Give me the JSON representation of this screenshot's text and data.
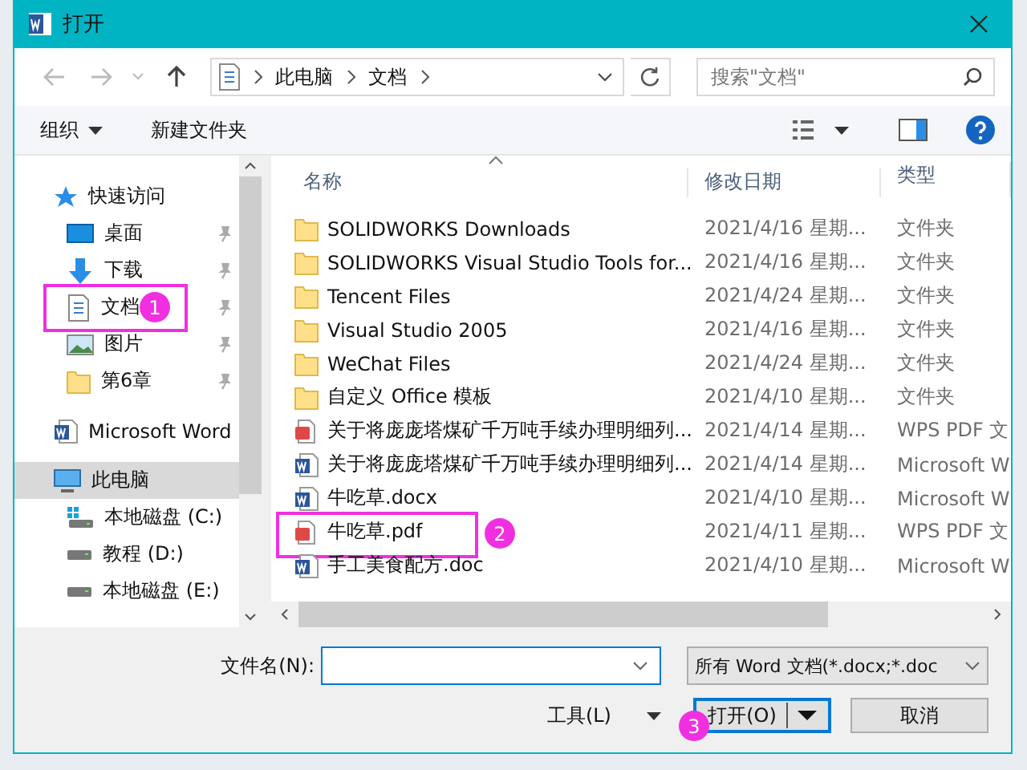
{
  "window": {
    "title": "打开"
  },
  "address": {
    "path": [
      "此电脑",
      "文档"
    ]
  },
  "search": {
    "placeholder": "搜索\"文档\""
  },
  "toolbar": {
    "organize": "组织",
    "new_folder": "新建文件夹"
  },
  "sidebar": {
    "items": [
      {
        "label": "快速访问",
        "kind": "star",
        "pinned": false,
        "selected": false
      },
      {
        "label": "桌面",
        "kind": "desktop",
        "pinned": true,
        "selected": false
      },
      {
        "label": "下载",
        "kind": "download",
        "pinned": true,
        "selected": false
      },
      {
        "label": "文档",
        "kind": "document",
        "pinned": true,
        "selected": false,
        "callout": "1"
      },
      {
        "label": "图片",
        "kind": "picture",
        "pinned": true,
        "selected": false
      },
      {
        "label": "第6章",
        "kind": "folder",
        "pinned": true,
        "selected": false
      },
      {
        "label": "Microsoft Word",
        "kind": "word",
        "pinned": false,
        "selected": false
      },
      {
        "label": "此电脑",
        "kind": "pc",
        "pinned": false,
        "selected": true
      },
      {
        "label": "本地磁盘 (C:)",
        "kind": "system-drive",
        "pinned": false,
        "selected": false
      },
      {
        "label": "教程 (D:)",
        "kind": "drive",
        "pinned": false,
        "selected": false
      },
      {
        "label": "本地磁盘 (E:)",
        "kind": "drive",
        "pinned": false,
        "selected": false
      }
    ]
  },
  "columns": [
    "名称",
    "修改日期",
    "类型"
  ],
  "rows": [
    {
      "name": "SOLIDWORKS Downloads",
      "date": "2021/4/16 星期...",
      "type": "文件夹",
      "kind": "folder"
    },
    {
      "name": "SOLIDWORKS Visual Studio Tools for...",
      "date": "2021/4/16 星期...",
      "type": "文件夹",
      "kind": "folder"
    },
    {
      "name": "Tencent Files",
      "date": "2021/4/24 星期...",
      "type": "文件夹",
      "kind": "folder"
    },
    {
      "name": "Visual Studio 2005",
      "date": "2021/4/16 星期...",
      "type": "文件夹",
      "kind": "folder"
    },
    {
      "name": "WeChat Files",
      "date": "2021/4/24 星期...",
      "type": "文件夹",
      "kind": "folder"
    },
    {
      "name": "自定义 Office 模板",
      "date": "2021/4/10 星期...",
      "type": "文件夹",
      "kind": "folder"
    },
    {
      "name": "关于将庞庞塔煤矿千万吨手续办理明细列...",
      "date": "2021/4/14 星期...",
      "type": "WPS PDF 文",
      "kind": "pdf"
    },
    {
      "name": "关于将庞庞塔煤矿千万吨手续办理明细列...",
      "date": "2021/4/14 星期...",
      "type": "Microsoft W",
      "kind": "word"
    },
    {
      "name": "牛吃草.docx",
      "date": "2021/4/10 星期...",
      "type": "Microsoft W",
      "kind": "word"
    },
    {
      "name": "牛吃草.pdf",
      "date": "2021/4/11 星期...",
      "type": "WPS PDF 文",
      "kind": "pdf",
      "callout": "2"
    },
    {
      "name": "手工美食配方.doc",
      "date": "2021/4/10 星期...",
      "type": "Microsoft W",
      "kind": "word"
    }
  ],
  "filename": {
    "label": "文件名(N):"
  },
  "filetype": {
    "value": "所有 Word 文档(*.docx;*.doc"
  },
  "tools": "工具(L)",
  "buttons": [
    {
      "label": "打开(O)",
      "kind": "split",
      "callout": "3"
    },
    {
      "label": "取消",
      "kind": "plain"
    }
  ]
}
